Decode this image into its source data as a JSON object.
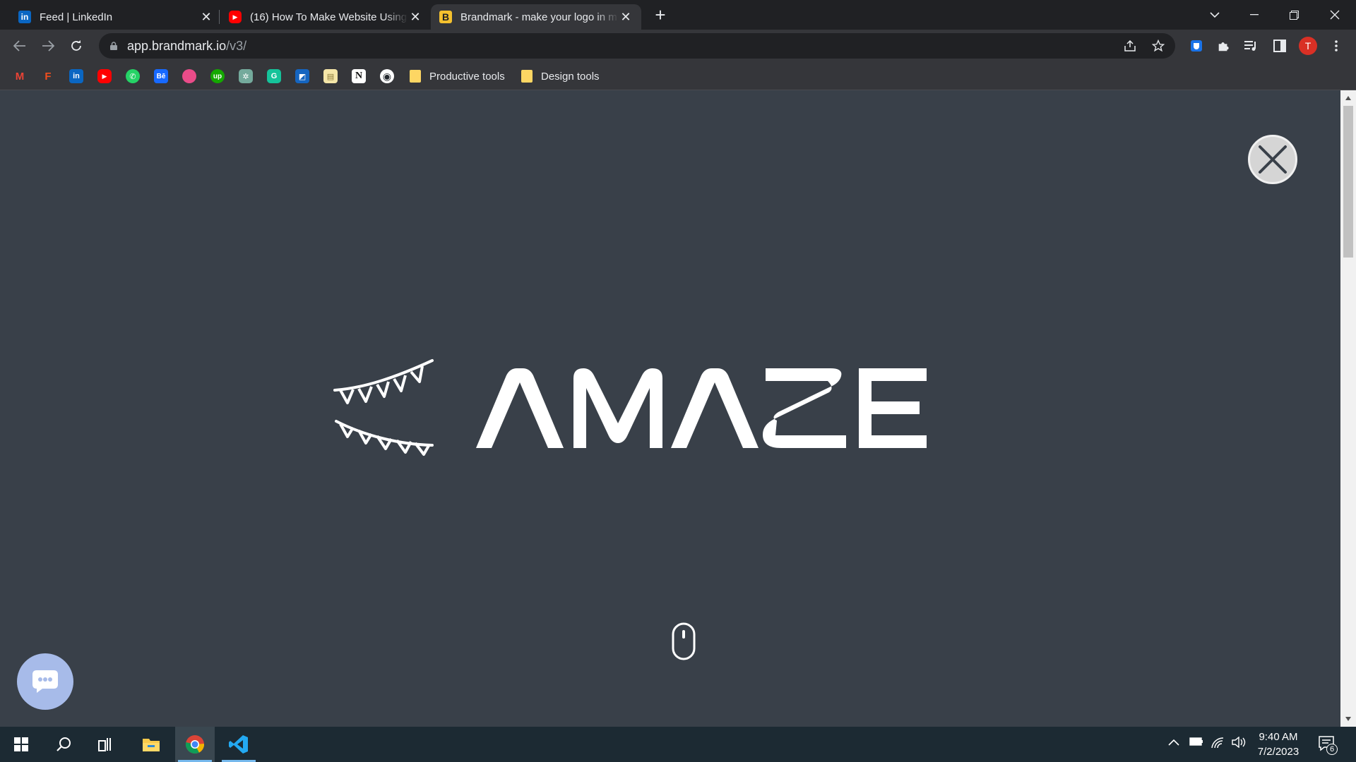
{
  "tabs": [
    {
      "title": "Feed | LinkedIn",
      "favicon": "in",
      "favicon_color": "#0a66c2"
    },
    {
      "title": "(16) How To Make Website Using",
      "favicon": "▶",
      "favicon_color": "#ff0000"
    },
    {
      "title": "Brandmark - make your logo in m",
      "favicon": "B",
      "favicon_color": "#f5c12e"
    }
  ],
  "new_tab_label": "+",
  "address": {
    "host": "app.brandmark.io",
    "path": "/v3/"
  },
  "profile_initial": "T",
  "bookmarks": {
    "folders": [
      {
        "label": "Productive tools"
      },
      {
        "label": "Design tools"
      }
    ],
    "icons": [
      {
        "name": "gmail",
        "glyph": "M",
        "color": "#ea4335"
      },
      {
        "name": "figma",
        "glyph": "F",
        "color": "#f24e1e"
      },
      {
        "name": "linkedin",
        "glyph": "in",
        "color": "#0a66c2"
      },
      {
        "name": "youtube",
        "glyph": "▶",
        "color": "#ff0000"
      },
      {
        "name": "whatsapp",
        "glyph": "✆",
        "color": "#25d366"
      },
      {
        "name": "behance",
        "glyph": "Bē",
        "color": "#1769ff"
      },
      {
        "name": "dribbble",
        "glyph": "●",
        "color": "#ea4c89"
      },
      {
        "name": "upwork",
        "glyph": "up",
        "color": "#14a800"
      },
      {
        "name": "chatgpt",
        "glyph": "✲",
        "color": "#74aa9c"
      },
      {
        "name": "grammarly",
        "glyph": "G",
        "color": "#15c39a"
      },
      {
        "name": "app",
        "glyph": "◩",
        "color": "#1565c0"
      },
      {
        "name": "notes",
        "glyph": "▤",
        "color": "#f5e6a8"
      },
      {
        "name": "notion",
        "glyph": "N",
        "color": "#ffffff"
      },
      {
        "name": "github",
        "glyph": "◉",
        "color": "#ffffff"
      }
    ]
  },
  "logo": {
    "wordmark": "AMAZE"
  },
  "colors": {
    "content_bg": "#394049",
    "accent_chat": "#a7bbe9"
  },
  "taskbar": {
    "time": "9:40 AM",
    "date": "7/2/2023",
    "notifications": "6"
  }
}
